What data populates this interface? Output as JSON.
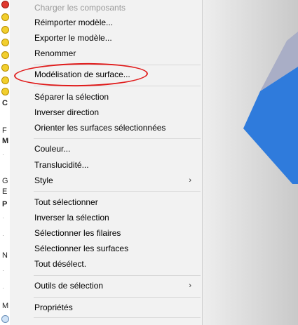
{
  "menu": {
    "items": [
      {
        "label": "Charger les composants",
        "disabled": true
      },
      {
        "label": "Réimporter modèle..."
      },
      {
        "label": "Exporter le modèle..."
      },
      {
        "label": "Renommer"
      },
      {
        "label": "Modélisation de surface..."
      },
      {
        "label": "Séparer la sélection"
      },
      {
        "label": "Inverser direction"
      },
      {
        "label": "Orienter les surfaces sélectionnées"
      },
      {
        "label": "Couleur..."
      },
      {
        "label": "Translucidité..."
      },
      {
        "label": "Style"
      },
      {
        "label": "Tout sélectionner"
      },
      {
        "label": "Inverser la sélection"
      },
      {
        "label": "Sélectionner les filaires"
      },
      {
        "label": "Sélectionner les surfaces"
      },
      {
        "label": "Tout désélect."
      },
      {
        "label": "Outils de sélection"
      },
      {
        "label": "Propriétés"
      }
    ],
    "submenu_arrow": "›"
  },
  "tree": {
    "letters": [
      "C",
      "F",
      "M",
      "G",
      "E",
      "P",
      "N",
      "M"
    ]
  },
  "annotation": {
    "color": "#e01b1b"
  },
  "colors": {
    "menu_bg": "#f2f2f2",
    "model_blue": "#2f7bdc",
    "model_slate": "#a9aec6"
  }
}
